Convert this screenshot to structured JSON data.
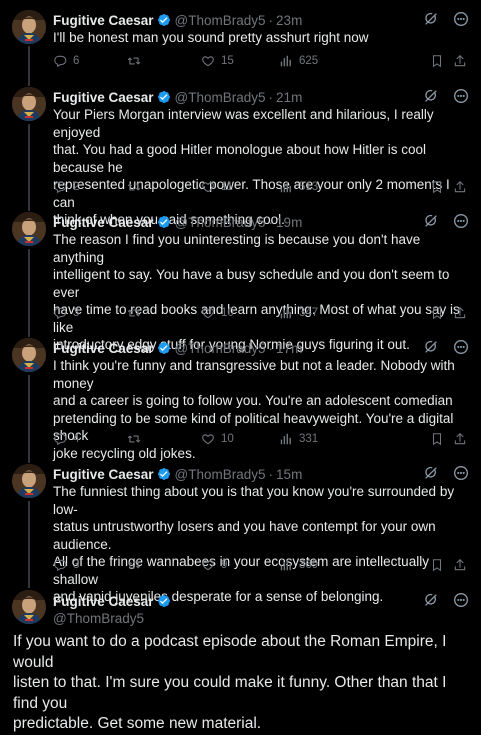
{
  "colors": {
    "background": "#000000",
    "text": "#e7e9ea",
    "muted": "#71767b",
    "verified": "#1d9bf0"
  },
  "author": {
    "name": "Fugitive Caesar",
    "handle": "@ThomBrady5"
  },
  "tweets": [
    {
      "time": "23m",
      "text": "I'll be honest man you sound pretty asshurt right now",
      "replies": "6",
      "retweets": "",
      "likes": "15",
      "views": "625"
    },
    {
      "time": "21m",
      "text": "Your Piers Morgan interview was excellent and hilarious, I really enjoyed\nthat. You had a good Hitler monologue about how Hitler is cool because he\nrepresented unapologetic power. Those are your only 2 moments I can\nthink of when you said something cool.",
      "replies": "2",
      "retweets": "",
      "likes": "11",
      "views": "513"
    },
    {
      "time": "19m",
      "text": "The reason I find you uninteresting is because you don't have anything\nintelligent to say. You have a busy schedule and you don't seem to ever\nhave time to read books and learn anything. Most of what you say is like\nintroductory edgy stuff for young Normie guys figuring it out.",
      "replies": "3",
      "retweets": "",
      "likes": "10",
      "views": "347"
    },
    {
      "time": "17m",
      "text": "I think you're funny and transgressive but not a leader. Nobody with money\nand a career is going to follow you. You're an adolescent comedian\npretending to be some kind of political heavyweight. You're a digital shock\njoke recycling old jokes.",
      "replies": "4",
      "retweets": "",
      "likes": "10",
      "views": "331"
    },
    {
      "time": "15m",
      "text": "The funniest thing about you is that you know you're surrounded by low-\nstatus untrustworthy losers and you have contempt for your own audience.\nAll of the fringe wannabees in your ecosystem are intellectually shallow\nand vapid juveniles desperate for a sense of belonging.",
      "replies": "3",
      "retweets": "",
      "likes": "9",
      "views": "369"
    }
  ],
  "final_tweet": {
    "text": "If you want to do a podcast episode about the Roman Empire, I would\nlisten to that. I'm sure you could make it funny. Other than that I find you\npredictable. Get some new material."
  },
  "icons": {
    "verified": "verified-badge-icon",
    "grok": "grok-icon",
    "more": "more-options-icon",
    "reply": "reply-icon",
    "retweet": "retweet-icon",
    "like": "heart-icon",
    "views": "views-chart-icon",
    "bookmark": "bookmark-icon",
    "share": "share-icon"
  }
}
